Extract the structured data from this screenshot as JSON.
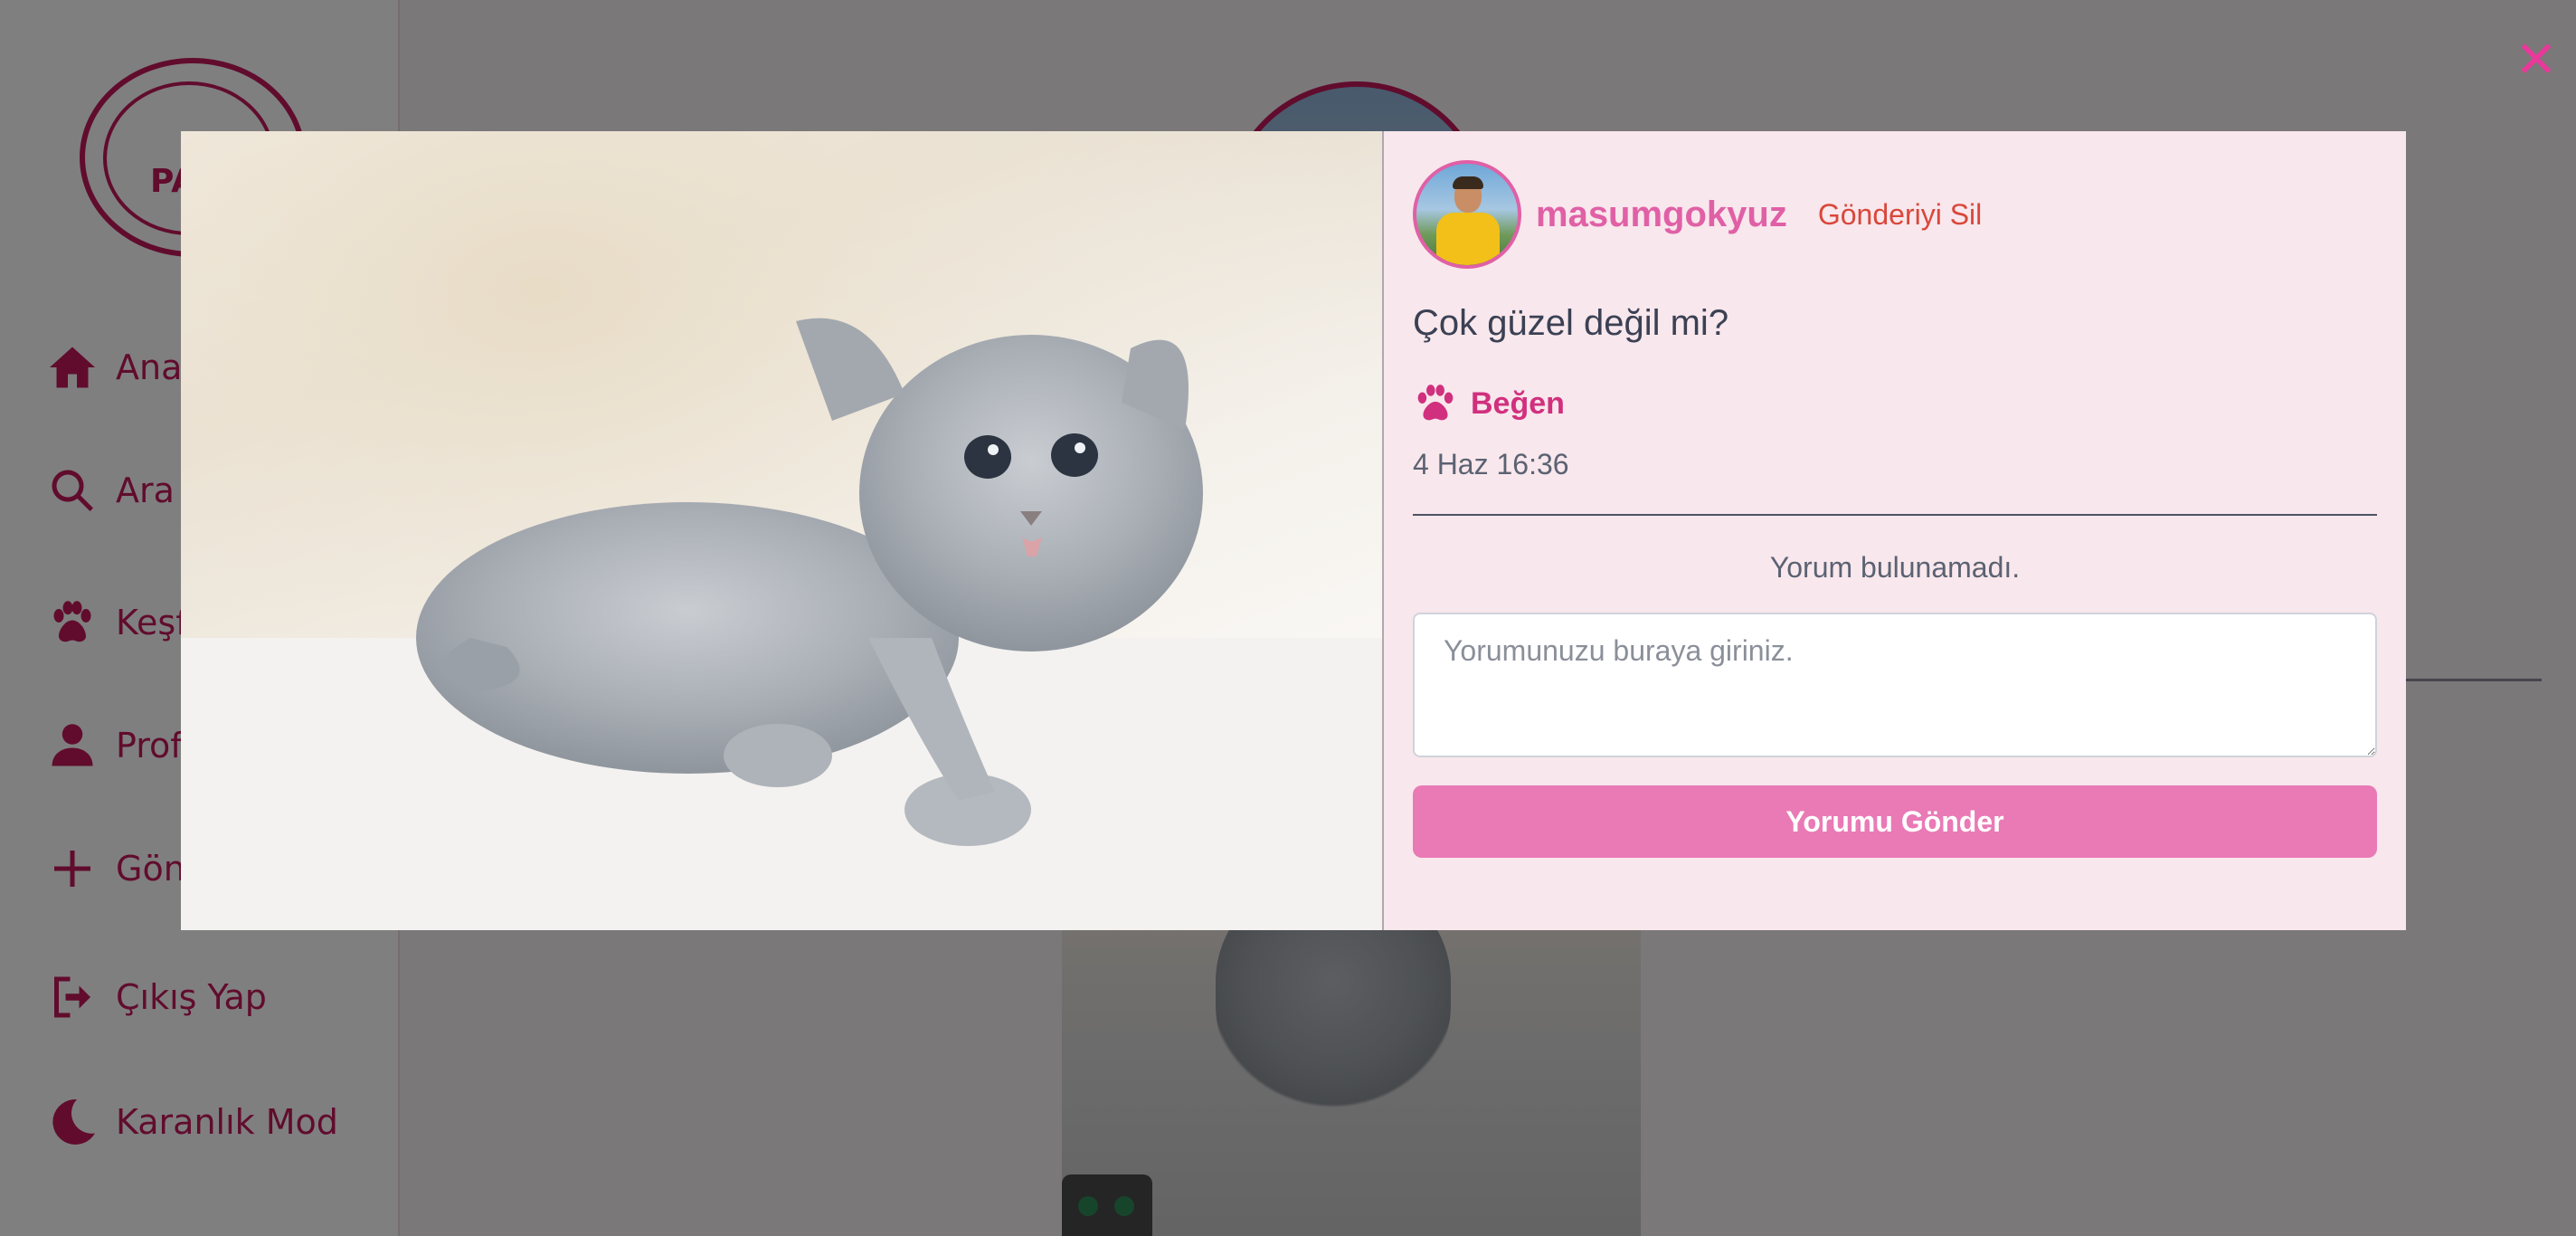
{
  "sidebar": {
    "logo_text": "PA",
    "items": [
      {
        "label": "Anas",
        "icon": "home-icon"
      },
      {
        "label": "Ara",
        "icon": "search-icon"
      },
      {
        "label": "Keşfe",
        "icon": "paw-icon"
      },
      {
        "label": "Profil",
        "icon": "user-icon"
      },
      {
        "label": "Gönd",
        "icon": "plus-icon"
      },
      {
        "label": "Çıkış Yap",
        "icon": "logout-icon"
      },
      {
        "label": "Karanlık Mod",
        "icon": "moon-icon"
      }
    ]
  },
  "modal": {
    "close_symbol": "✕",
    "post": {
      "username": "masumgokyuz",
      "delete_label": "Gönderiyi Sil",
      "caption": "Çok güzel değil mi?",
      "like_label": "Beğen",
      "timestamp": "4 Haz 16:36"
    },
    "comments": {
      "empty_text": "Yorum bulunamadı.",
      "input_placeholder": "Yorumunuzu buraya giriniz.",
      "submit_label": "Yorumu Gönder"
    }
  },
  "colors": {
    "brand": "#c2185b",
    "accent_pink": "#e060a6",
    "delete_red": "#d9473b",
    "button_pink": "#e97ab6",
    "modal_bg": "#f8e7ec"
  }
}
